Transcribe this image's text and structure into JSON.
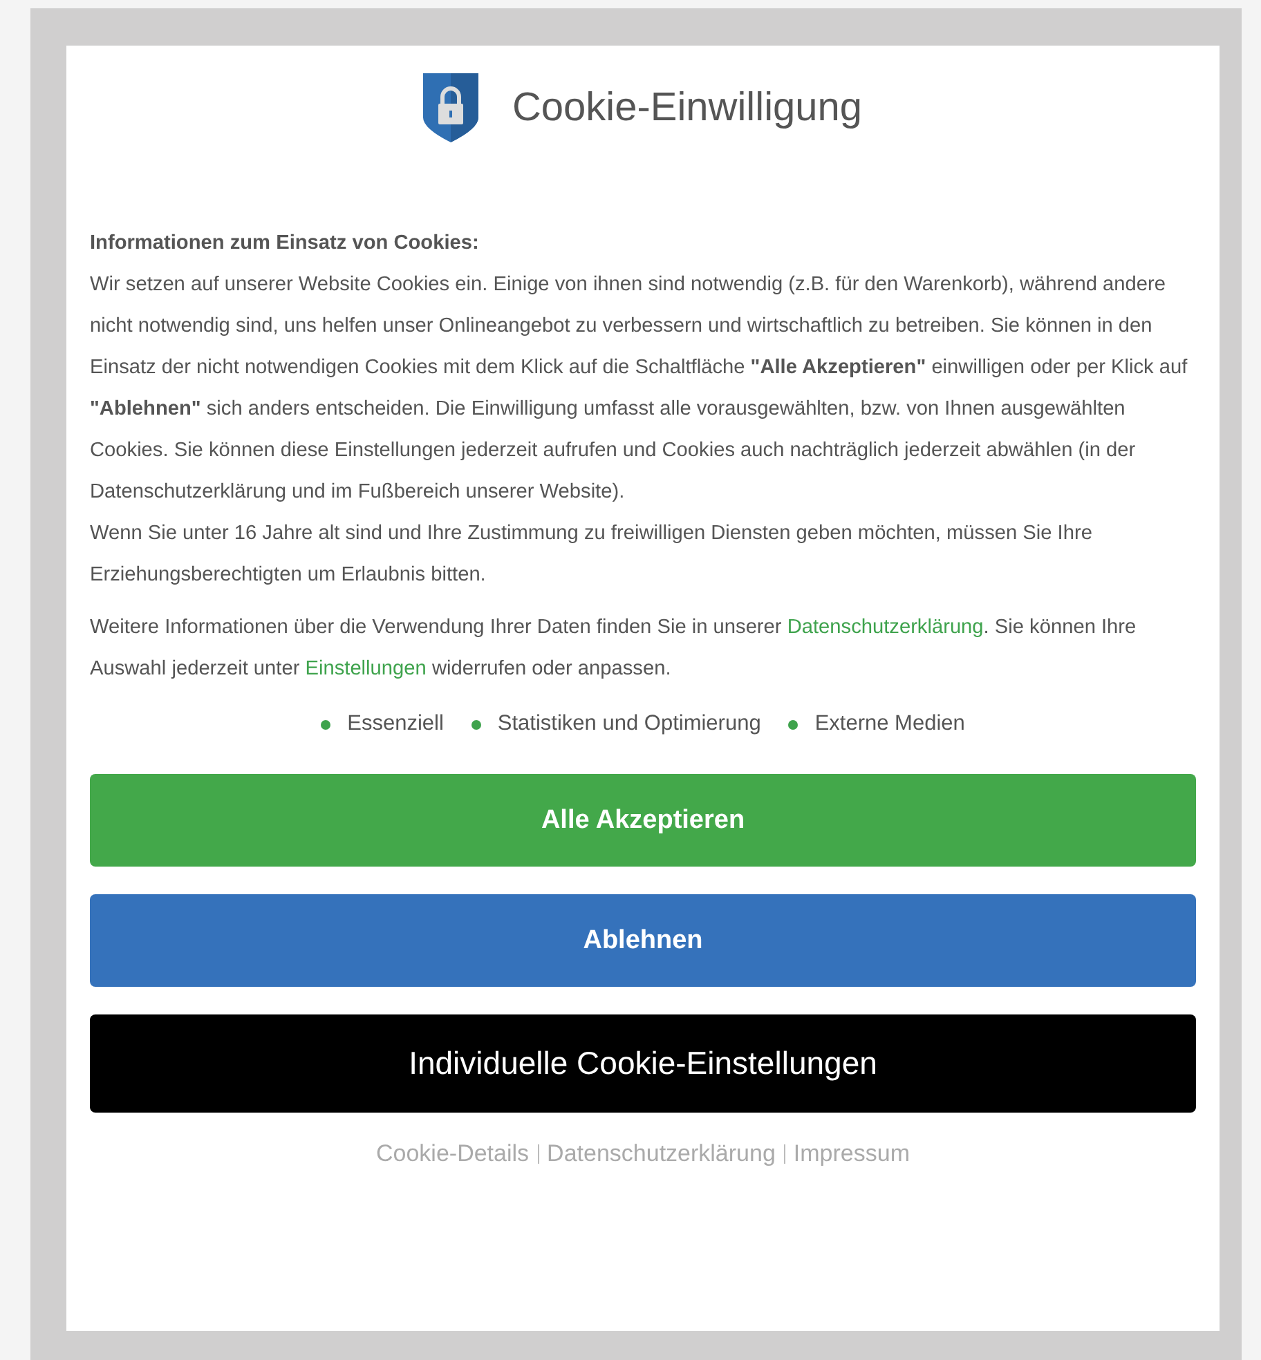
{
  "dialog": {
    "title": "Cookie-Einwilligung",
    "heading": "Informationen zum Einsatz von Cookies:",
    "paragraphs": [
      "Wir setzen auf unserer Website Cookies ein. Einige von ihnen sind notwendig (z.B. für den Warenkorb), während andere nicht notwendig sind, uns helfen unser Onlineangebot zu verbessern und wirtschaftlich zu betreiben. Sie können in den Einsatz der nicht notwendigen Cookies mit dem Klick auf die Schaltfläche **\"Alle Akzeptieren\"** einwilligen oder per Klick auf **\"Ablehnen\"** sich anders entscheiden. Die Einwilligung umfasst alle vorausgewählten, bzw. von Ihnen ausgewählten Cookies. Sie können diese Einstellungen jederzeit aufrufen und Cookies auch nachträglich jederzeit abwählen (in der Datenschutzerklärung und im Fußbereich unserer Website).",
      "Wenn Sie unter 16 Jahre alt sind und Ihre Zustimmung zu freiwilligen Diensten geben möchten, müssen Sie Ihre Erziehungsberechtigten um Erlaubnis bitten."
    ],
    "more_info": [
      {
        "kind": "text",
        "text": "Weitere Informationen über die Verwendung Ihrer Daten finden Sie in unserer "
      },
      {
        "kind": "link",
        "text": "Datenschutzerklärung"
      },
      {
        "kind": "text",
        "text": ". Sie können Ihre Auswahl jederzeit unter "
      },
      {
        "kind": "link",
        "text": "Einstellungen"
      },
      {
        "kind": "text",
        "text": " widerrufen oder anpassen."
      }
    ],
    "categories": [
      {
        "label": "Essenziell",
        "color": "#3fa34d"
      },
      {
        "label": "Statistiken und Optimierung",
        "color": "#3fa34d"
      },
      {
        "label": "Externe Medien",
        "color": "#3fa34d"
      }
    ],
    "buttons": [
      {
        "kind": "accept",
        "label": "Alle Akzeptieren"
      },
      {
        "kind": "reject",
        "label": "Ablehnen"
      },
      {
        "kind": "settings",
        "label": "Individuelle Cookie-Einstellungen"
      }
    ],
    "footer_links": [
      "Cookie-Details",
      "Datenschutzerklärung",
      "Impressum"
    ]
  }
}
